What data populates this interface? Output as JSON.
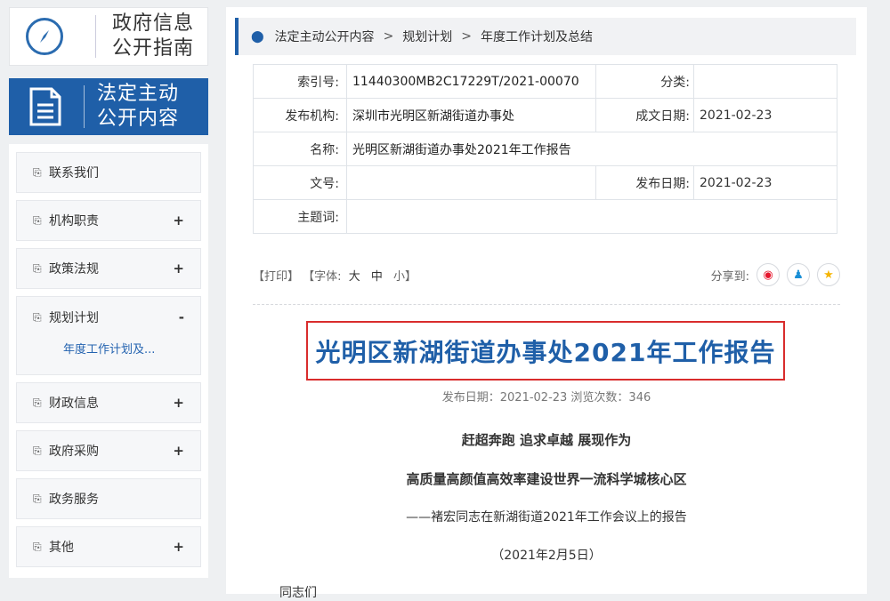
{
  "sidebar": {
    "guide_title_line1": "政府信息",
    "guide_title_line2": "公开指南",
    "active_title_line1": "法定主动",
    "active_title_line2": "公开内容",
    "items": [
      {
        "label": "联系我们",
        "toggle": ""
      },
      {
        "label": "机构职责",
        "toggle": "+"
      },
      {
        "label": "政策法规",
        "toggle": "+"
      },
      {
        "label": "规划计划",
        "toggle": "-"
      },
      {
        "label": "财政信息",
        "toggle": "+"
      },
      {
        "label": "政府采购",
        "toggle": "+"
      },
      {
        "label": "政务服务",
        "toggle": ""
      },
      {
        "label": "其他",
        "toggle": "+"
      }
    ],
    "sub_item": "年度工作计划及..."
  },
  "breadcrumb": {
    "items": [
      "法定主动公开内容",
      "规划计划",
      "年度工作计划及总结"
    ],
    "separator": ">"
  },
  "meta": {
    "index_label": "索引号:",
    "index_value": "11440300MB2C17229T/2021-00070",
    "category_label": "分类:",
    "category_value": "",
    "publisher_label": "发布机构:",
    "publisher_value": "深圳市光明区新湖街道办事处",
    "created_label": "成文日期:",
    "created_value": "2021-02-23",
    "name_label": "名称:",
    "name_value": "光明区新湖街道办事处2021年工作报告",
    "docno_label": "文号:",
    "docno_value": "",
    "published_label": "发布日期:",
    "published_value": "2021-02-23",
    "subject_label": "主题词:",
    "subject_value": ""
  },
  "tools": {
    "print": "【打印】",
    "font_prefix": "【字体:",
    "font_large": "大",
    "font_medium": "中",
    "font_small": "小】",
    "share_label": "分享到:"
  },
  "article": {
    "title": "光明区新湖街道办事处2021年工作报告",
    "pub_info": "发布日期：2021-02-23 浏览次数：346",
    "line1": "赶超奔跑 追求卓越 展现作为",
    "line2": "高质量高颜值高效率建设世界一流科学城核心区",
    "line3": "——褚宏同志在新湖街道2021年工作会议上的报告",
    "line4": "（2021年2月5日）",
    "line5": "同志们"
  },
  "colors": {
    "brand_blue": "#1f5fa8",
    "highlight_red": "#d92c2c"
  }
}
